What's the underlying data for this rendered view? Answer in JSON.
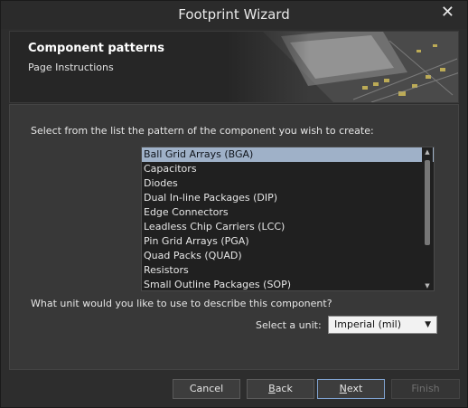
{
  "window": {
    "title": "Footprint Wizard",
    "close_icon": "close-icon"
  },
  "header": {
    "title": "Component patterns",
    "subtitle": "Page Instructions"
  },
  "main": {
    "instruction": "Select from the list the pattern of the component you wish to create:",
    "patterns": [
      "Ball Grid Arrays (BGA)",
      "Capacitors",
      "Diodes",
      "Dual In-line Packages (DIP)",
      "Edge Connectors",
      "Leadless Chip Carriers (LCC)",
      "Pin Grid Arrays (PGA)",
      "Quad Packs (QUAD)",
      "Resistors",
      "Small Outline Packages (SOP)"
    ],
    "selected_pattern": "Ball Grid Arrays (BGA)",
    "unit_question": "What unit would you like to use to describe this component?",
    "unit_label": "Select a unit:",
    "unit_value": "Imperial (mil)"
  },
  "buttons": {
    "cancel": "Cancel",
    "back_first": "B",
    "back_rest": "ack",
    "next_first": "N",
    "next_rest": "ext",
    "finish": "Finish"
  },
  "colors": {
    "selection": "#9fb1c8",
    "accent_border": "#7fa2d0"
  }
}
